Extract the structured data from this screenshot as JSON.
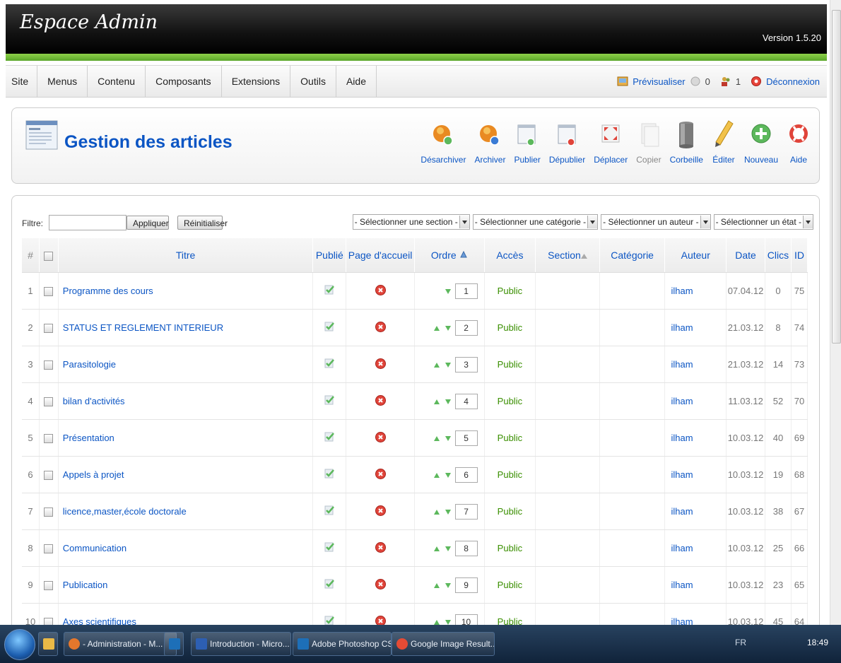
{
  "header": {
    "title": "Espace Admin",
    "version": "Version 1.5.20"
  },
  "menu": {
    "items": [
      "Site",
      "Menus",
      "Contenu",
      "Composants",
      "Extensions",
      "Outils",
      "Aide"
    ]
  },
  "topnav": {
    "preview": "Prévisualiser",
    "messages": "0",
    "users": "1",
    "logout": "Déconnexion"
  },
  "page": {
    "title": "Gestion des articles"
  },
  "toolbar": {
    "unarchive": "Désarchiver",
    "archive": "Archiver",
    "publish": "Publier",
    "unpublish": "Dépublier",
    "move": "Déplacer",
    "copy": "Copier",
    "trash": "Corbeille",
    "edit": "Éditer",
    "new": "Nouveau",
    "help": "Aide"
  },
  "filter": {
    "label": "Filtre:",
    "value": "",
    "apply": "Appliquer",
    "reset": "Réinitialiser",
    "section": "- Sélectionner une section -",
    "category": "- Sélectionner une catégorie -",
    "author": "- Sélectionner un auteur -",
    "state": "- Sélectionner un état -"
  },
  "table": {
    "headers": {
      "num": "#",
      "title": "Titre",
      "published": "Publié",
      "frontpage": "Page d'accueil",
      "order": "Ordre",
      "access": "Accès",
      "section": "Section",
      "category": "Catégorie",
      "author": "Auteur",
      "date": "Date",
      "hits": "Clics",
      "id": "ID"
    },
    "rows": [
      {
        "num": "1",
        "title": "Programme des cours",
        "order": "1",
        "access": "Public",
        "section": "",
        "category": "",
        "author": "ilham",
        "date": "07.04.12",
        "hits": "0",
        "id": "75",
        "up": false
      },
      {
        "num": "2",
        "title": "STATUS ET REGLEMENT INTERIEUR",
        "order": "2",
        "access": "Public",
        "section": "",
        "category": "",
        "author": "ilham",
        "date": "21.03.12",
        "hits": "8",
        "id": "74",
        "up": true
      },
      {
        "num": "3",
        "title": "Parasitologie",
        "order": "3",
        "access": "Public",
        "section": "",
        "category": "",
        "author": "ilham",
        "date": "21.03.12",
        "hits": "14",
        "id": "73",
        "up": true
      },
      {
        "num": "4",
        "title": "bilan d'activités",
        "order": "4",
        "access": "Public",
        "section": "",
        "category": "",
        "author": "ilham",
        "date": "11.03.12",
        "hits": "52",
        "id": "70",
        "up": true
      },
      {
        "num": "5",
        "title": "Présentation",
        "order": "5",
        "access": "Public",
        "section": "",
        "category": "",
        "author": "ilham",
        "date": "10.03.12",
        "hits": "40",
        "id": "69",
        "up": true
      },
      {
        "num": "6",
        "title": "Appels à projet",
        "order": "6",
        "access": "Public",
        "section": "",
        "category": "",
        "author": "ilham",
        "date": "10.03.12",
        "hits": "19",
        "id": "68",
        "up": true
      },
      {
        "num": "7",
        "title": "licence,master,école doctorale",
        "order": "7",
        "access": "Public",
        "section": "",
        "category": "",
        "author": "ilham",
        "date": "10.03.12",
        "hits": "38",
        "id": "67",
        "up": true
      },
      {
        "num": "8",
        "title": "Communication",
        "order": "8",
        "access": "Public",
        "section": "",
        "category": "",
        "author": "ilham",
        "date": "10.03.12",
        "hits": "25",
        "id": "66",
        "up": true
      },
      {
        "num": "9",
        "title": "Publication",
        "order": "9",
        "access": "Public",
        "section": "",
        "category": "",
        "author": "ilham",
        "date": "10.03.12",
        "hits": "23",
        "id": "65",
        "up": true
      },
      {
        "num": "10",
        "title": "Axes scientifiques",
        "order": "10",
        "access": "Public",
        "section": "",
        "category": "",
        "author": "ilham",
        "date": "10.03.12",
        "hits": "45",
        "id": "64",
        "up": true
      }
    ]
  },
  "taskbar": {
    "items": [
      "- Administration - M...",
      "",
      "Introduction - Micro...",
      "Adobe Photoshop CS5",
      "Google Image Result..."
    ],
    "language": "FR",
    "clock": "18:49"
  },
  "colors": {
    "accent": "#0b55c4",
    "green": "#5ba72a",
    "access": "#3a8f00"
  }
}
